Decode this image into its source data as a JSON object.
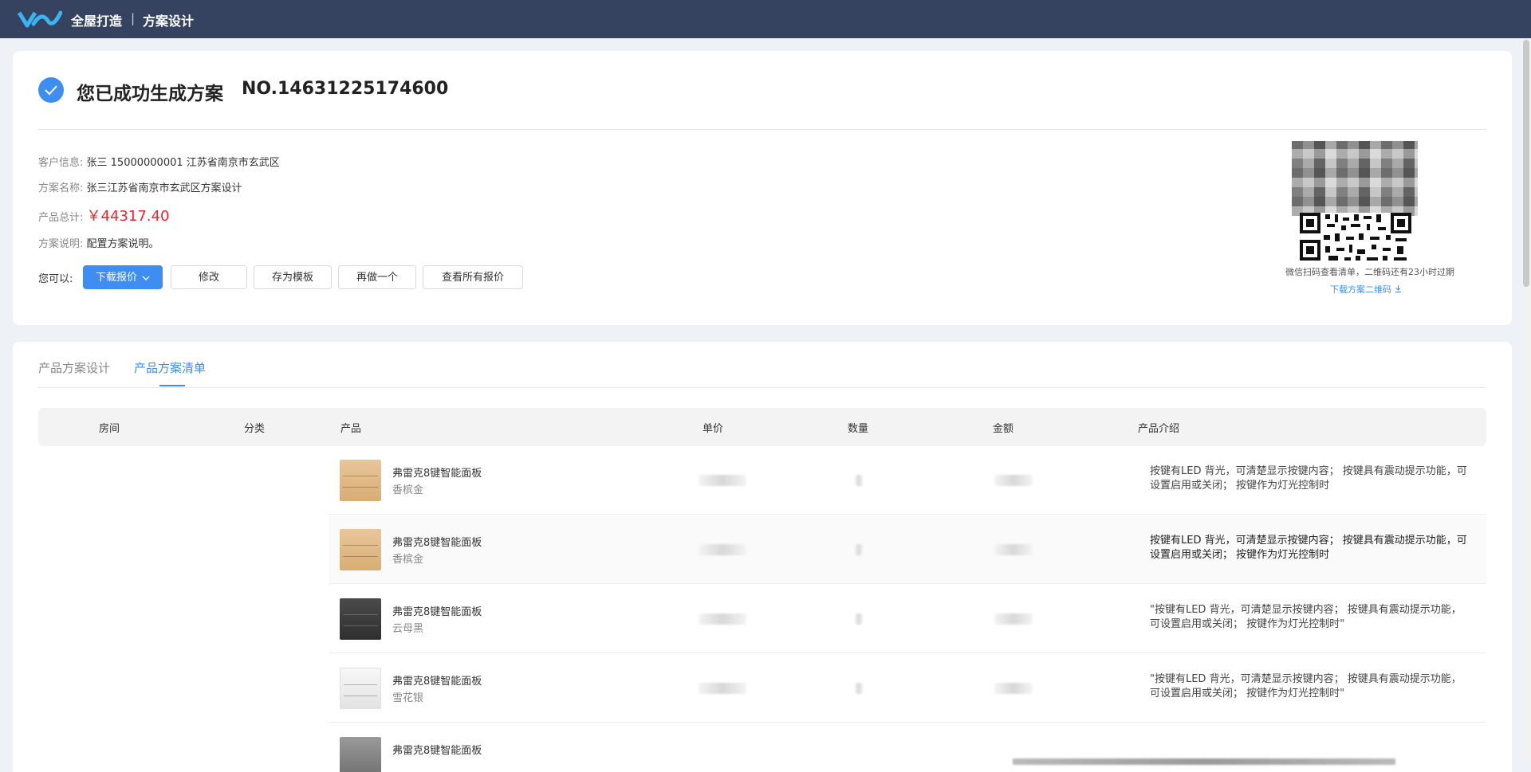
{
  "header": {
    "brand": "全屋打造",
    "separator": "|",
    "subtitle": "方案设计"
  },
  "result": {
    "title": "您已成功生成方案",
    "number": "NO.14631225174600"
  },
  "info": {
    "customer_label": "客户信息:",
    "customer_value": "张三  15000000001  江苏省南京市玄武区",
    "plan_name_label": "方案名称:",
    "plan_name_value": "张三江苏省南京市玄武区方案设计",
    "total_label": "产品总计:",
    "total_value": "￥44317.40",
    "desc_label": "方案说明:",
    "desc_value": "配置方案说明。"
  },
  "actions": {
    "label": "您可以:",
    "download_quote": "下载报价",
    "modify": "修改",
    "save_template": "存为模板",
    "redo": "再做一个",
    "view_all": "查看所有报价"
  },
  "qr": {
    "caption": "微信扫码查看清单，二维码还有23小时过期",
    "download": "下载方案二维码"
  },
  "tabs": [
    "产品方案设计",
    "产品方案清单"
  ],
  "active_tab": 1,
  "table": {
    "headers": {
      "room": "房间",
      "category": "分类",
      "product": "产品",
      "unit_price": "单价",
      "quantity": "数量",
      "amount": "金额",
      "intro": "产品介绍"
    },
    "rows": [
      {
        "name": "弗雷克8键智能面板",
        "color": "香槟金",
        "desc": "按键有LED 背光，可清楚显示按键内容； 按键具有震动提示功能，可设置启用或关闭； 按键作为灯光控制时",
        "swatch": "gold"
      },
      {
        "name": "弗雷克8键智能面板",
        "color": "香槟金",
        "desc": "按键有LED 背光，可清楚显示按键内容； 按键具有震动提示功能，可设置启用或关闭； 按键作为灯光控制时",
        "swatch": "gold"
      },
      {
        "name": "弗雷克8键智能面板",
        "color": "云母黑",
        "desc": "\"按键有LED 背光，可清楚显示按键内容； 按键具有震动提示功能，可设置启用或关闭； 按键作为灯光控制时\"",
        "swatch": "black"
      },
      {
        "name": "弗雷克8键智能面板",
        "color": "雪花银",
        "desc": "\"按键有LED 背光，可清楚显示按键内容； 按键具有震动提示功能，可设置启用或关闭； 按键作为灯光控制时\"",
        "swatch": "silver"
      },
      {
        "name": "弗雷克8键智能面板",
        "color": "",
        "desc": "",
        "swatch": "grey"
      }
    ]
  },
  "colors": {
    "topbar": "#354360",
    "accent": "#3d8ef0",
    "price_red": "#f5222d"
  }
}
